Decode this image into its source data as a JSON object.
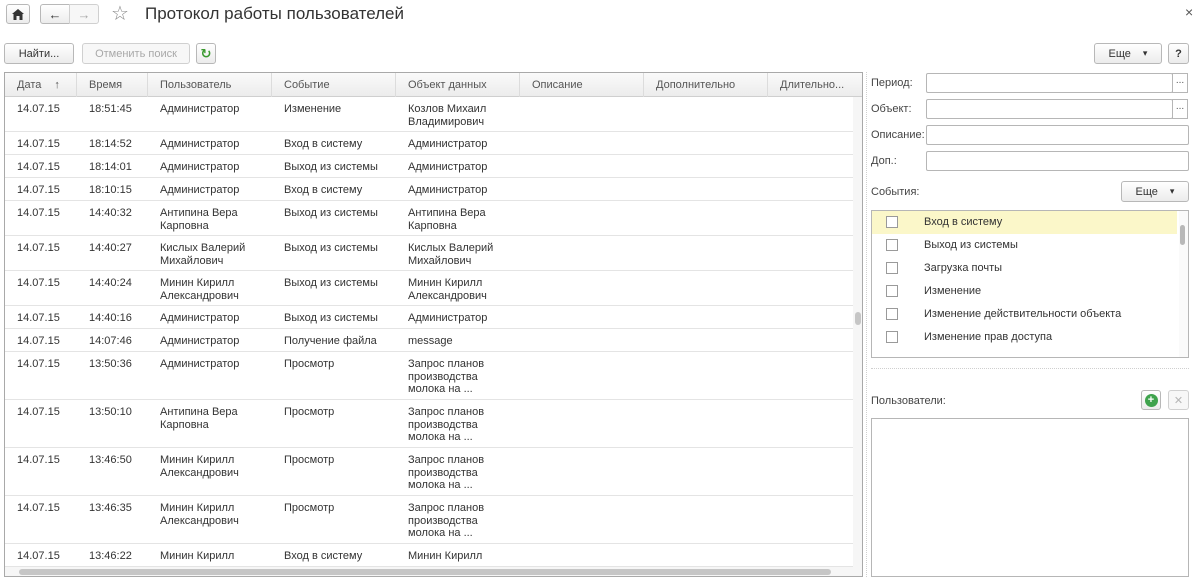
{
  "window": {
    "title": "Протокол работы пользователей",
    "close_glyph": "×",
    "home_glyph": "⌂",
    "back_glyph": "←",
    "forward_glyph": "→",
    "favorite_glyph": "☆"
  },
  "toolbar": {
    "find_label": "Найти...",
    "cancel_search_label": "Отменить поиск",
    "refresh_glyph": "↻",
    "more_label": "Еще",
    "more_arrow": "▾",
    "help_label": "?"
  },
  "table": {
    "columns": [
      "Дата",
      "Время",
      "Пользователь",
      "Событие",
      "Объект данных",
      "Описание",
      "Дополнительно",
      "Длительно..."
    ],
    "sort_glyph": "↑",
    "rows": [
      {
        "date": "14.07.15",
        "time": "18:51:45",
        "user": [
          "Администратор"
        ],
        "event": "Изменение",
        "object": [
          "Козлов Михаил",
          "Владимирович"
        ]
      },
      {
        "date": "14.07.15",
        "time": "18:14:52",
        "user": [
          "Администратор"
        ],
        "event": "Вход в систему",
        "object": [
          "Администратор"
        ]
      },
      {
        "date": "14.07.15",
        "time": "18:14:01",
        "user": [
          "Администратор"
        ],
        "event": "Выход из системы",
        "object": [
          "Администратор"
        ]
      },
      {
        "date": "14.07.15",
        "time": "18:10:15",
        "user": [
          "Администратор"
        ],
        "event": "Вход в систему",
        "object": [
          "Администратор"
        ]
      },
      {
        "date": "14.07.15",
        "time": "14:40:32",
        "user": [
          "Антипина Вера",
          "Карповна"
        ],
        "event": "Выход из системы",
        "object": [
          "Антипина Вера",
          "Карповна"
        ]
      },
      {
        "date": "14.07.15",
        "time": "14:40:27",
        "user": [
          "Кислых Валерий",
          "Михайлович"
        ],
        "event": "Выход из системы",
        "object": [
          "Кислых Валерий",
          "Михайлович"
        ]
      },
      {
        "date": "14.07.15",
        "time": "14:40:24",
        "user": [
          "Минин Кирилл",
          "Александрович"
        ],
        "event": "Выход из системы",
        "object": [
          "Минин Кирилл",
          "Александрович"
        ]
      },
      {
        "date": "14.07.15",
        "time": "14:40:16",
        "user": [
          "Администратор"
        ],
        "event": "Выход из системы",
        "object": [
          "Администратор"
        ]
      },
      {
        "date": "14.07.15",
        "time": "14:07:46",
        "user": [
          "Администратор"
        ],
        "event": "Получение файла",
        "object": [
          "message"
        ]
      },
      {
        "date": "14.07.15",
        "time": "13:50:36",
        "user": [
          "Администратор"
        ],
        "event": "Просмотр",
        "object": [
          "Запрос планов",
          "производства",
          "молока на ..."
        ]
      },
      {
        "date": "14.07.15",
        "time": "13:50:10",
        "user": [
          "Антипина Вера",
          "Карповна"
        ],
        "event": "Просмотр",
        "object": [
          "Запрос планов",
          "производства",
          "молока на ..."
        ]
      },
      {
        "date": "14.07.15",
        "time": "13:46:50",
        "user": [
          "Минин Кирилл",
          "Александрович"
        ],
        "event": "Просмотр",
        "object": [
          "Запрос планов",
          "производства",
          "молока на ..."
        ]
      },
      {
        "date": "14.07.15",
        "time": "13:46:35",
        "user": [
          "Минин Кирилл",
          "Александрович"
        ],
        "event": "Просмотр",
        "object": [
          "Запрос планов",
          "производства",
          "молока на ..."
        ]
      },
      {
        "date": "14.07.15",
        "time": "13:46:22",
        "user": [
          "Минин Кирилл"
        ],
        "event": "Вход в систему",
        "object": [
          "Минин Кирилл"
        ]
      }
    ]
  },
  "filters": {
    "period_label": "Период:",
    "object_label": "Объект:",
    "description_label": "Описание:",
    "additional_label": "Доп.:",
    "select_glyph": "...",
    "events_label": "События:",
    "events_more_label": "Еще",
    "events": [
      {
        "label": "Вход в систему",
        "checked": false
      },
      {
        "label": "Выход из системы",
        "checked": false
      },
      {
        "label": "Загрузка почты",
        "checked": false
      },
      {
        "label": "Изменение",
        "checked": false
      },
      {
        "label": "Изменение действительности объекта",
        "checked": false
      },
      {
        "label": "Изменение прав доступа",
        "checked": false
      }
    ],
    "users_label": "Пользователи:",
    "add_user_glyph": "+",
    "remove_user_glyph": "✕"
  },
  "colors": {
    "selected_row": "#fbf7c9",
    "refresh_green": "#3a9a2f",
    "add_green": "#3fa34d"
  }
}
